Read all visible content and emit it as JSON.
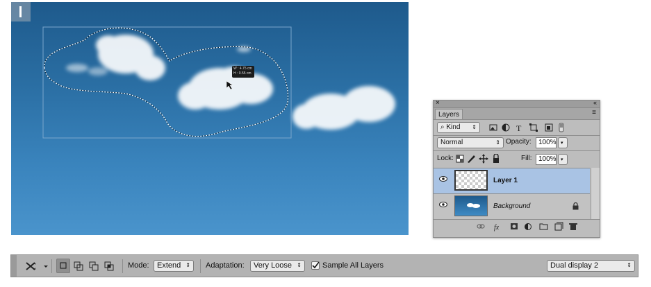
{
  "canvas": {
    "readout_w": "W : 4.75 cm",
    "readout_h": "H : 0.55 cm"
  },
  "layers_panel": {
    "close_glyph": "×",
    "collapse_glyph": "«",
    "tab_label": "Layers",
    "menu_glyph": "≡",
    "filter": {
      "search_glyph": "⌕",
      "label": "Kind",
      "arrow": "⇕"
    },
    "filter_icons": [
      "image-filter-icon",
      "adjustment-filter-icon",
      "type-filter-icon",
      "shape-filter-icon",
      "smart-object-filter-icon",
      "filter-toggle-icon"
    ],
    "blend_mode": "Normal",
    "opacity_label": "Opacity:",
    "opacity_value": "100%",
    "lock_label": "Lock:",
    "fill_label": "Fill:",
    "fill_value": "100%",
    "layers": [
      {
        "name": "Layer 1",
        "visible": true,
        "selected": true,
        "locked": false
      },
      {
        "name": "Background",
        "visible": true,
        "selected": false,
        "locked": true
      }
    ],
    "footer_icons": [
      "link-layers-icon",
      "fx-icon",
      "add-mask-icon",
      "adjustment-layer-icon",
      "new-group-icon",
      "new-layer-icon",
      "trash-icon"
    ],
    "fx_label": "fx"
  },
  "options_bar": {
    "mode_label": "Mode:",
    "mode_value": "Extend",
    "adaptation_label": "Adaptation:",
    "adaptation_value": "Very Loose",
    "sample_all_label": "Sample All Layers",
    "sample_all_checked": true,
    "display_value": "Dual display 2"
  },
  "colors": {
    "selected_layer": "#a9c3e4",
    "panel_bg": "#bdbdbd",
    "bar_bg": "#b3b3b3"
  }
}
